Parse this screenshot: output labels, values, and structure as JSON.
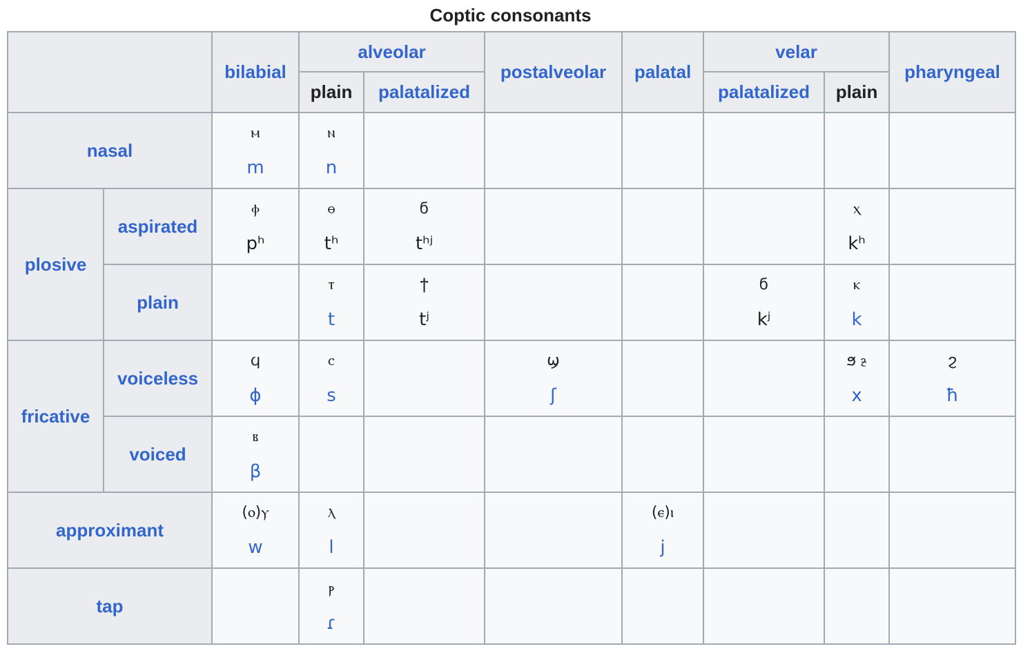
{
  "title": "Coptic consonants",
  "colors": {
    "link": "#3366cc",
    "text": "#202122",
    "header_bg": "#eaecf0",
    "cell_bg": "#f8f9fa",
    "border": "#a2a9b1"
  },
  "columns": {
    "bilabial": "bilabial",
    "alveolar": "alveolar",
    "alveolar_plain": "plain",
    "alveolar_palatalized": "palatalized",
    "postalveolar": "postalveolar",
    "palatal": "palatal",
    "velar": "velar",
    "velar_palatalized": "palatalized",
    "velar_plain": "plain",
    "pharyngeal": "pharyngeal"
  },
  "rows": {
    "nasal": "nasal",
    "plosive": "plosive",
    "aspirated": "aspirated",
    "plain": "plain",
    "fricative": "fricative",
    "voiceless": "voiceless",
    "voiced": "voiced",
    "approximant": "approximant",
    "tap": "tap"
  },
  "cells": {
    "nasal": {
      "bilabial": {
        "coptic": "ⲙ",
        "ipa": "m",
        "ipa_link": true
      },
      "alveolar_plain": {
        "coptic": "ⲛ",
        "ipa": "n",
        "ipa_link": true
      }
    },
    "plosive_aspirated": {
      "bilabial": {
        "coptic": "ⲫ",
        "ipa": "pʰ",
        "ipa_link": false
      },
      "alveolar_plain": {
        "coptic": "ⲑ",
        "ipa": "tʰ",
        "ipa_link": false
      },
      "alveolar_palatalized": {
        "coptic": "ϭ",
        "ipa": "tʰʲ",
        "ipa_link": false
      },
      "velar_plain": {
        "coptic": "ⲭ",
        "ipa": "kʰ",
        "ipa_link": false
      }
    },
    "plosive_plain": {
      "alveolar_plain": {
        "coptic": "ⲧ",
        "ipa": "t",
        "ipa_link": true
      },
      "alveolar_palatalized": {
        "coptic": "ϯ",
        "ipa": "tʲ",
        "ipa_link": false
      },
      "velar_palatalized": {
        "coptic": "ϭ",
        "ipa": "kʲ",
        "ipa_link": false
      },
      "velar_plain": {
        "coptic": "ⲕ",
        "ipa": "k",
        "ipa_link": true
      }
    },
    "fricative_voiceless": {
      "bilabial": {
        "coptic": "ϥ",
        "ipa": "ɸ",
        "ipa_link": true
      },
      "alveolar_plain": {
        "coptic": "ⲥ",
        "ipa": "s",
        "ipa_link": true
      },
      "postalveolar": {
        "coptic": "ϣ",
        "ipa": "ʃ",
        "ipa_link": true
      },
      "velar_plain": {
        "coptic": "ϧ ⳉ",
        "ipa": "x",
        "ipa_link": true
      },
      "pharyngeal": {
        "coptic": "ϩ",
        "ipa": "ħ",
        "ipa_link": true
      }
    },
    "fricative_voiced": {
      "bilabial": {
        "coptic": "ⲃ",
        "ipa": "β",
        "ipa_link": true
      }
    },
    "approximant": {
      "bilabial": {
        "coptic": "(ⲟ)ⲩ",
        "ipa": "w",
        "ipa_link": true
      },
      "alveolar_plain": {
        "coptic": "ⲗ",
        "ipa": "l",
        "ipa_link": true
      },
      "palatal": {
        "coptic": "(ⲉ)ⲓ",
        "ipa": "j",
        "ipa_link": true
      }
    },
    "tap": {
      "alveolar_plain": {
        "coptic": "ⲣ",
        "ipa": "ɾ",
        "ipa_link": true
      }
    }
  }
}
